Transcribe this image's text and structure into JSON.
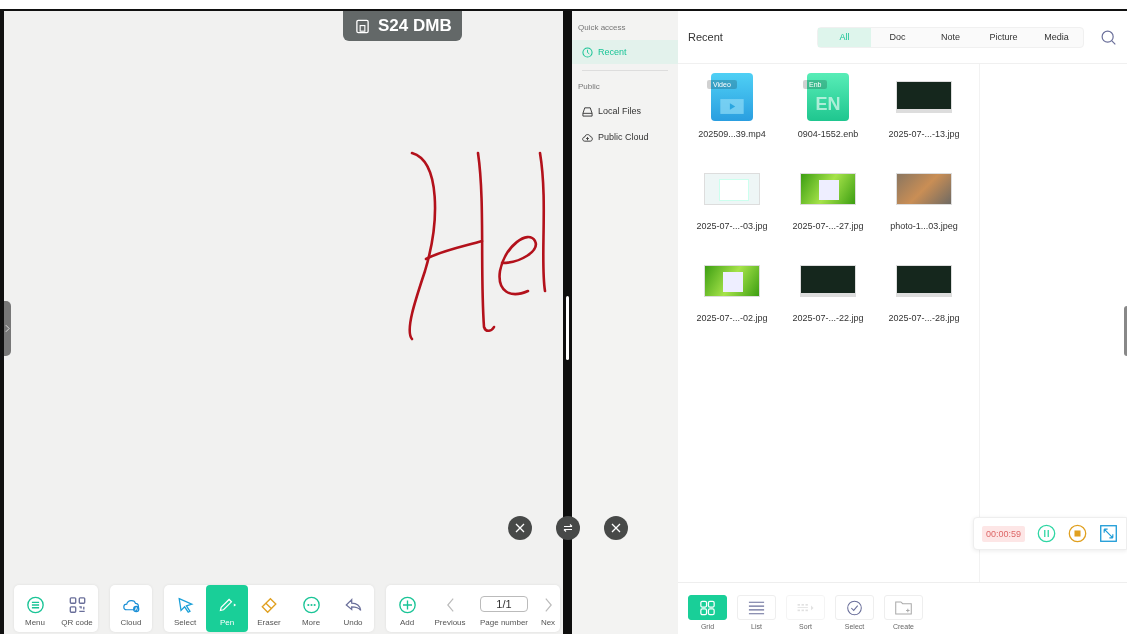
{
  "whiteboard": {
    "device_badge": "S24 DMB",
    "toolbar_groups": [
      [
        {
          "kind": "menu",
          "label": "Menu",
          "selected": false
        },
        {
          "kind": "qr",
          "label": "QR code",
          "selected": false
        }
      ],
      [
        {
          "kind": "cloud",
          "label": "Cloud",
          "selected": false
        }
      ],
      [
        {
          "kind": "select",
          "label": "Select",
          "selected": false
        },
        {
          "kind": "pen",
          "label": "Pen",
          "selected": true
        },
        {
          "kind": "eraser",
          "label": "Eraser",
          "selected": false
        },
        {
          "kind": "more",
          "label": "More",
          "selected": false
        },
        {
          "kind": "undo",
          "label": "Undo",
          "selected": false
        }
      ],
      [
        {
          "kind": "add",
          "label": "Add",
          "selected": false
        },
        {
          "kind": "previous",
          "label": "Previous",
          "selected": false
        },
        {
          "kind": "page",
          "label": "Page number",
          "value": "1/1",
          "selected": false
        },
        {
          "kind": "next",
          "label": "Nex",
          "selected": false
        }
      ]
    ]
  },
  "file_manager": {
    "sidebar": {
      "sections": [
        {
          "heading": "Quick access",
          "items": [
            {
              "kind": "recent",
              "label": "Recent",
              "selected": true
            }
          ]
        },
        {
          "heading": "Public",
          "items": [
            {
              "kind": "drive",
              "label": "Local Files",
              "selected": false
            },
            {
              "kind": "cloud",
              "label": "Public Cloud",
              "selected": false
            }
          ]
        }
      ]
    },
    "title": "Recent",
    "filters": [
      {
        "label": "All",
        "selected": true
      },
      {
        "label": "Doc",
        "selected": false
      },
      {
        "label": "Note",
        "selected": false
      },
      {
        "label": "Picture",
        "selected": false
      },
      {
        "label": "Media",
        "selected": false
      }
    ],
    "files": [
      {
        "kind": "video",
        "badge": "Video",
        "name": "202509...39.mp4"
      },
      {
        "kind": "enb",
        "badge": "Enb",
        "mark": "EN",
        "name": "0904-1552.enb"
      },
      {
        "kind": "dark",
        "name": "2025-07-...-13.jpg"
      },
      {
        "kind": "light",
        "name": "2025-07-...-03.jpg"
      },
      {
        "kind": "green",
        "name": "2025-07-...-27.jpg"
      },
      {
        "kind": "photo",
        "name": "photo-1...03.jpeg"
      },
      {
        "kind": "green",
        "name": "2025-07-...-02.jpg"
      },
      {
        "kind": "dark",
        "name": "2025-07-...-22.jpg"
      },
      {
        "kind": "dark",
        "name": "2025-07-...-28.jpg"
      }
    ],
    "recorder": {
      "time": "00:00:59"
    },
    "toolbar": [
      {
        "kind": "grid",
        "label": "Grid",
        "selected": true,
        "disabled": false
      },
      {
        "kind": "list",
        "label": "List",
        "selected": false,
        "disabled": false
      },
      {
        "kind": "sort",
        "label": "Sort",
        "selected": false,
        "disabled": true
      },
      {
        "kind": "select",
        "label": "Select",
        "selected": false,
        "disabled": false
      },
      {
        "kind": "create",
        "label": "Create",
        "selected": false,
        "disabled": false
      }
    ]
  }
}
